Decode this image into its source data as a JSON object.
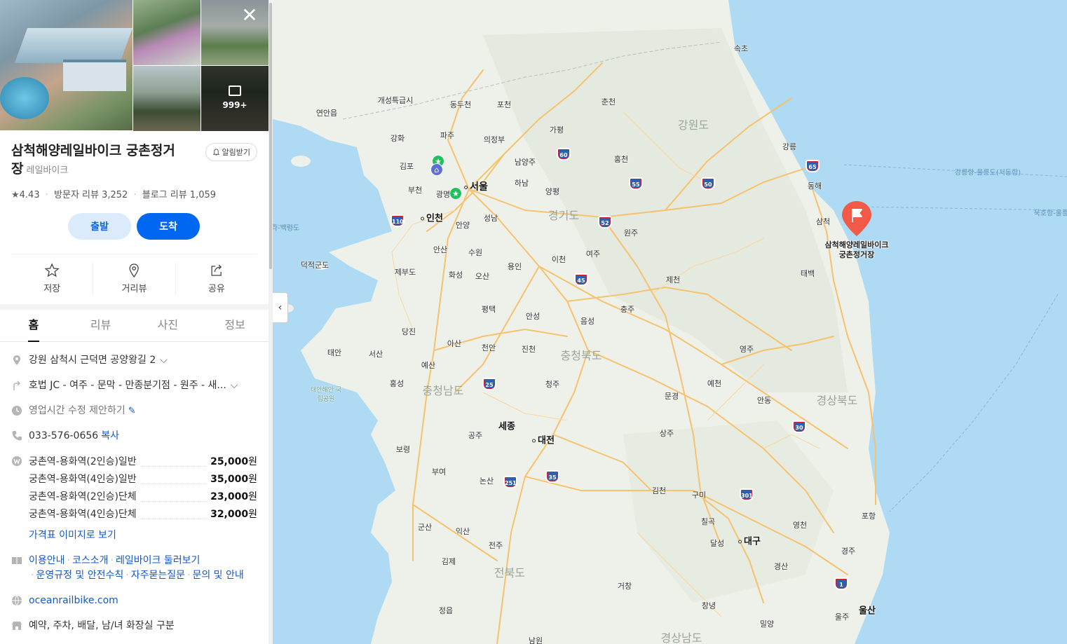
{
  "panel": {
    "photo_count": "999+",
    "place_name": "삼척해양레일바이크 궁촌정거장",
    "category": "레일바이크",
    "alert_label": "알림받기",
    "rating": "4.43",
    "visitor_reviews": "방문자 리뷰 3,252",
    "blog_reviews": "블로그 리뷰 1,059",
    "depart_label": "출발",
    "arrive_label": "도착",
    "actions": {
      "save": "저장",
      "streetview": "거리뷰",
      "share": "공유"
    },
    "tabs": [
      "홈",
      "리뷰",
      "사진",
      "정보"
    ],
    "address": "강원 삼척시 근덕면 공양왕길 2",
    "directions": "호법 JC - 여주 - 문막 - 만종분기점 - 원주 - 새...",
    "hours": "영업시간 수정 제안하기",
    "phone": "033-576-0656",
    "copy_label": "복사",
    "prices": [
      {
        "name": "궁촌역-용화역(2인승)일반",
        "value": "25,000",
        "unit": "원"
      },
      {
        "name": "궁촌역-용화역(4인승)일반",
        "value": "35,000",
        "unit": "원"
      },
      {
        "name": "궁촌역-용화역(2인승)단체",
        "value": "23,000",
        "unit": "원"
      },
      {
        "name": "궁촌역-용화역(4인승)단체",
        "value": "32,000",
        "unit": "원"
      }
    ],
    "price_image_link": "가격표 이미지로 보기",
    "menu_links": [
      "이용안내",
      "코스소개",
      "레일바이크 둘러보기",
      "운영규정 및 안전수칙",
      "자주묻는질문",
      "문의 및 안내"
    ],
    "website": "oceanrailbike.com",
    "amenities": "예약, 주차, 배달, 남/녀 화장실 구분"
  },
  "map": {
    "pin_label_line1": "삼척해양레일바이크",
    "pin_label_line2": "궁촌정거장",
    "collapse_icon": "‹",
    "labels": [
      {
        "text": "속초"
      },
      {
        "text": "개성특급시"
      },
      {
        "text": "동두천"
      },
      {
        "text": "포천"
      },
      {
        "text": "춘천"
      },
      {
        "text": "연안읍"
      },
      {
        "text": "파주"
      },
      {
        "text": "의정부"
      },
      {
        "text": "가평"
      },
      {
        "text": "강화"
      },
      {
        "text": "김포"
      },
      {
        "text": "남양주"
      },
      {
        "text": "홍천"
      },
      {
        "text": "강릉"
      },
      {
        "text": "부천"
      },
      {
        "text": "광명"
      },
      {
        "text": "하남"
      },
      {
        "text": "양평"
      },
      {
        "text": "동해"
      },
      {
        "text": "인천"
      },
      {
        "text": "안양"
      },
      {
        "text": "성남"
      },
      {
        "text": "원주"
      },
      {
        "text": "삼척"
      },
      {
        "text": "안산"
      },
      {
        "text": "수원"
      },
      {
        "text": "여주"
      },
      {
        "text": "덕적군도"
      },
      {
        "text": "제부도"
      },
      {
        "text": "화성"
      },
      {
        "text": "오산"
      },
      {
        "text": "용인"
      },
      {
        "text": "이천"
      },
      {
        "text": "제천"
      },
      {
        "text": "태백"
      },
      {
        "text": "평택"
      },
      {
        "text": "충주"
      },
      {
        "text": "당진"
      },
      {
        "text": "안성"
      },
      {
        "text": "음성"
      },
      {
        "text": "태안"
      },
      {
        "text": "서산"
      },
      {
        "text": "아산"
      },
      {
        "text": "천안"
      },
      {
        "text": "진천"
      },
      {
        "text": "영주"
      },
      {
        "text": "예산"
      },
      {
        "text": "홍성"
      },
      {
        "text": "청주"
      },
      {
        "text": "예천"
      },
      {
        "text": "문경"
      },
      {
        "text": "안동"
      },
      {
        "text": "세종"
      },
      {
        "text": "공주"
      },
      {
        "text": "대전"
      },
      {
        "text": "상주"
      },
      {
        "text": "보령"
      },
      {
        "text": "부여"
      },
      {
        "text": "논산"
      },
      {
        "text": "김천"
      },
      {
        "text": "구미"
      },
      {
        "text": "칠곡"
      },
      {
        "text": "영천"
      },
      {
        "text": "포항"
      },
      {
        "text": "군산"
      },
      {
        "text": "익산"
      },
      {
        "text": "전주"
      },
      {
        "text": "달성"
      },
      {
        "text": "대구"
      },
      {
        "text": "경주"
      },
      {
        "text": "김제"
      },
      {
        "text": "경산"
      },
      {
        "text": "거창"
      },
      {
        "text": "창녕"
      },
      {
        "text": "정읍"
      },
      {
        "text": "밀양"
      },
      {
        "text": "울주"
      },
      {
        "text": "울산"
      },
      {
        "text": "남원"
      },
      {
        "text": "서울"
      }
    ],
    "provinces": [
      "강원도",
      "경기도",
      "충청북도",
      "충청남도",
      "경상북도",
      "전북도",
      "경상남도"
    ],
    "park_label": "태안해안 국립공원",
    "sea_labels": [
      "강릉항-울릉도(저동항)",
      "묵호항-울릉도",
      "라-백령도"
    ],
    "shields": [
      "60",
      "65",
      "55",
      "50",
      "110",
      "52",
      "45",
      "25",
      "30",
      "35",
      "251",
      "301",
      "1"
    ],
    "colors": {
      "sea": "#aedaf3",
      "land": "#eef1ea",
      "road": "#f6c26d",
      "pin": "#f05a46",
      "primary_button": "#0068f0"
    }
  }
}
